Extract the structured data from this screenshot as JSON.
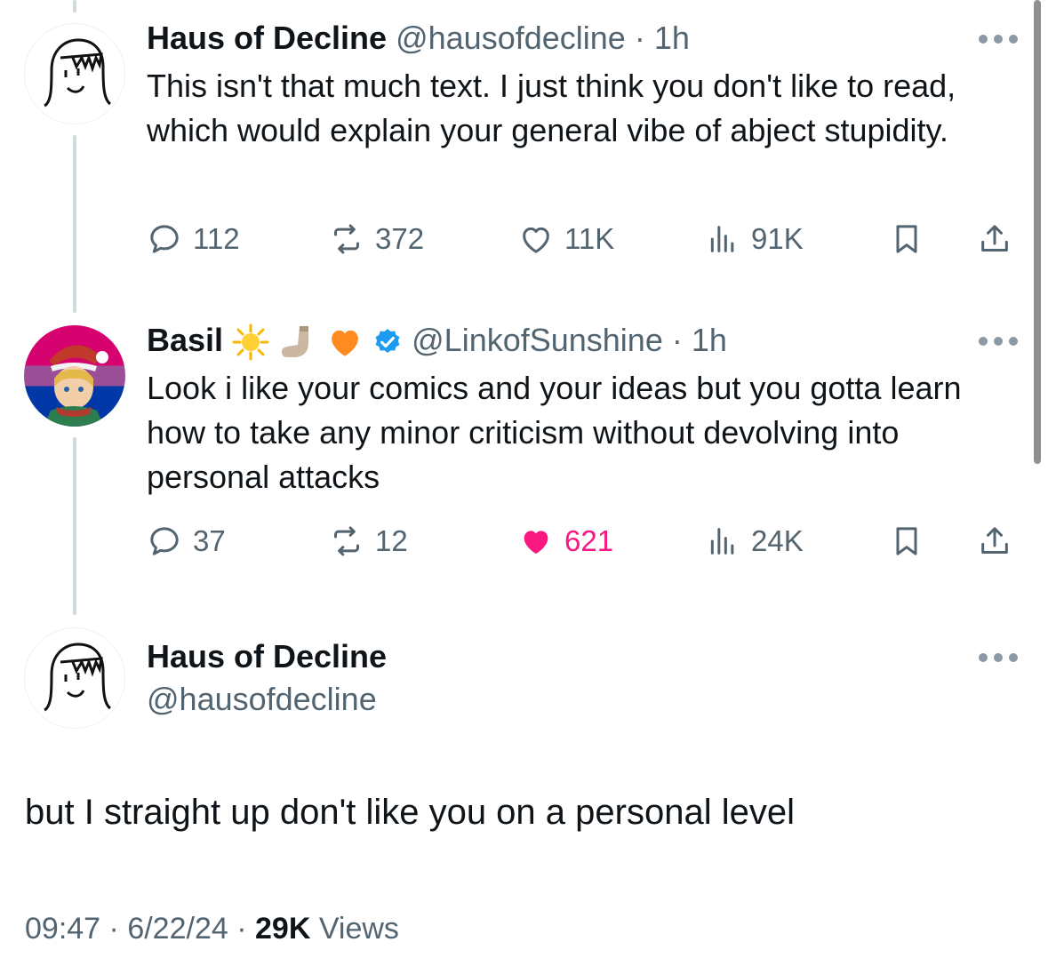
{
  "tweets": [
    {
      "name": "Haus of Decline",
      "handle": "@hausofdecline",
      "time": "· 1h",
      "text": "This isn't that much text. I just think you don't like to read, which would explain your general vibe of abject stupidity.",
      "replies": "112",
      "reposts": "372",
      "likes": "11K",
      "views": "91K",
      "liked": false
    },
    {
      "name": "Basil",
      "handle": "@LinkofSunshine",
      "time": "· 1h",
      "text": "Look i like your comics and your ideas but you gotta learn how to take any minor criticism without devolving into personal attacks",
      "replies": "37",
      "reposts": "12",
      "likes": "621",
      "views": "24K",
      "liked": true,
      "verified": true
    }
  ],
  "main_tweet": {
    "name": "Haus of Decline",
    "handle": "@hausofdecline",
    "text": "but I straight up don't like you on a personal level",
    "time": "09:47",
    "date": "6/22/24",
    "views_count": "29K",
    "views_label": "Views",
    "sep": "·"
  },
  "colors": {
    "text": "#0f1419",
    "secondary": "#536471",
    "like_pink": "#f91880",
    "verified_blue": "#1d9bf0",
    "thread_line": "#cfd9de"
  },
  "icons": [
    "reply-icon",
    "repost-icon",
    "like-icon",
    "views-icon",
    "bookmark-icon",
    "share-icon",
    "more-icon",
    "verified-badge-icon"
  ]
}
